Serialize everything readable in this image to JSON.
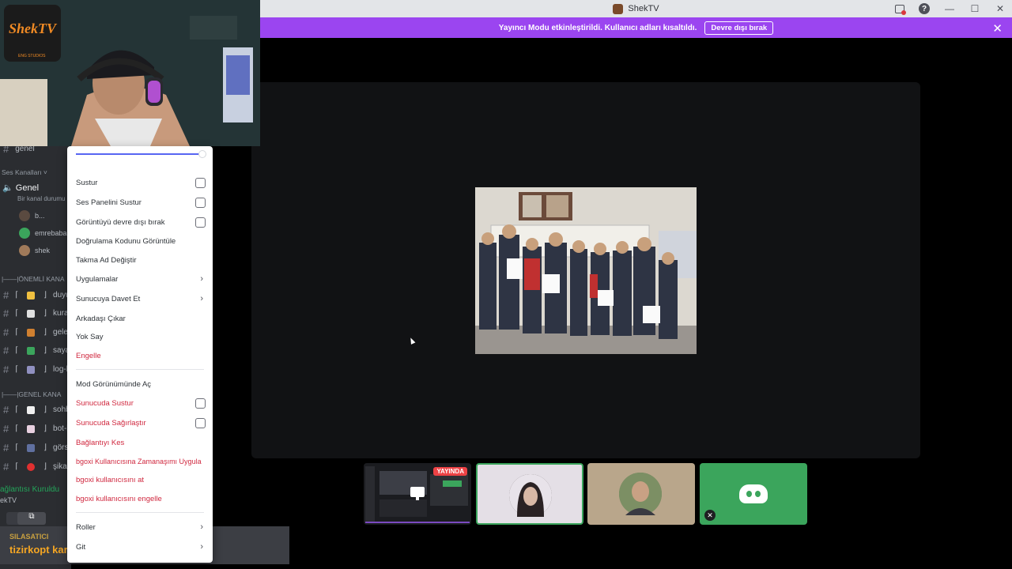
{
  "titlebar": {
    "app_name": "ShekTV"
  },
  "banner": {
    "message": "Yayıncı Modu etkinleştirildi. Kullanıcı adları kısaltıldı.",
    "button_label": "Devre dışı bırak",
    "close_glyph": "✕"
  },
  "webcam": {
    "logo_text": "ShekTV",
    "logo_sub": "ENG STUDIOS"
  },
  "stream_tile": {
    "live_label": "YAYINDA"
  },
  "sidebar": {
    "top_channel": "genel",
    "voice_category": "Ses Kanalları ˅",
    "voice_channel": "Genel",
    "voice_sub": "Bir kanal durumu",
    "users": [
      "b...",
      "emrebaba",
      "shek"
    ],
    "important_category": "|——|ÖNEMLİ KANA",
    "important_channels": [
      "duyuru",
      "kural",
      "gelen",
      "sayaç",
      "log-k"
    ],
    "general_category": "|——|GENEL KANA",
    "general_channels": [
      "sohbe",
      "bot-k",
      "görse",
      "şikaye"
    ],
    "connection_status": "ağlantısı Kuruldu",
    "server_name": "ekTV"
  },
  "overlay": {
    "line1": "SILASATICI",
    "line2": "tizirkopt karyall"
  },
  "menu": {
    "mute": "Sustur",
    "mute_soundboard": "Ses Panelini Sustur",
    "disable_video": "Görüntüyü devre dışı bırak",
    "view_verification": "Doğrulama Kodunu Görüntüle",
    "change_nickname": "Takma Ad Değiştir",
    "apps": "Uygulamalar",
    "invite_to_server": "Sunucuya Davet Et",
    "remove_friend": "Arkadaşı Çıkar",
    "ignore": "Yok Say",
    "block": "Engelle",
    "open_mod_view": "Mod Görünümünde Aç",
    "server_mute": "Sunucuda Sustur",
    "server_deafen": "Sunucuda Sağırlaştır",
    "disconnect": "Bağlantıyı Kes",
    "timeout_user": "bgoxi Kullanıcısına Zamanaşımı Uygula",
    "kick_user": "bgoxi kullanıcısını at",
    "ban_user": "bgoxi kullanıcısını engelle",
    "roles": "Roller",
    "more": "Git"
  },
  "colors": {
    "accent": "#9b45f0",
    "danger": "#d0283f",
    "online": "#3ba55c",
    "blurple": "#5865f2"
  }
}
